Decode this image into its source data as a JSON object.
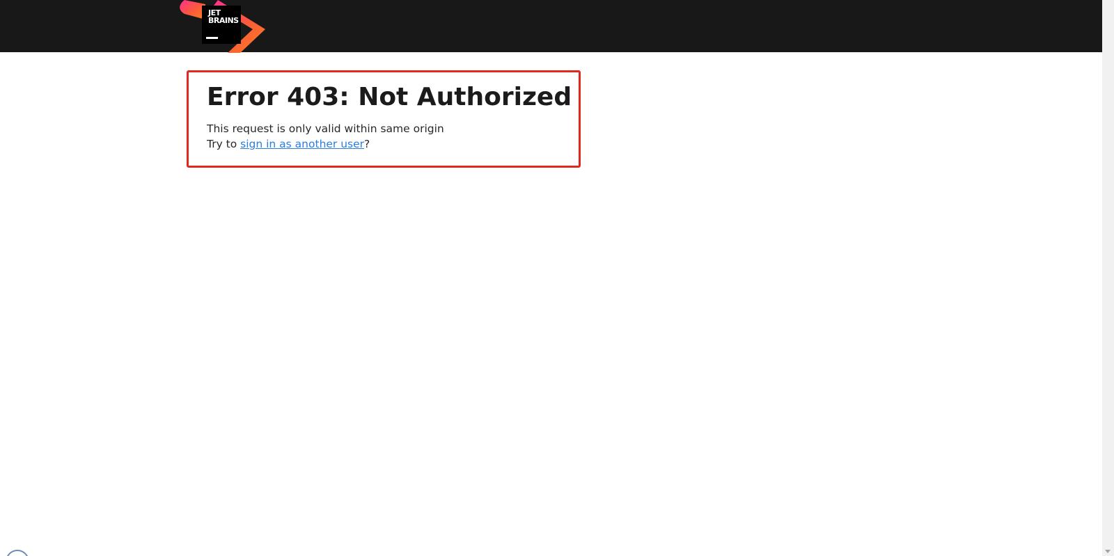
{
  "header": {
    "logo": {
      "line1": "JET",
      "line2": "BRAINS",
      "icon": "jetbrains-logo",
      "colors": [
        "#ff318c",
        "#fc801d",
        "#000000"
      ]
    }
  },
  "error": {
    "title": "Error 403: Not Authorized",
    "message": "This request is only valid within same origin",
    "prompt_prefix": "Try to ",
    "link_text": "sign in as another user",
    "prompt_suffix": "?",
    "border_color": "#e0281e",
    "link_color": "#2a7de1"
  }
}
